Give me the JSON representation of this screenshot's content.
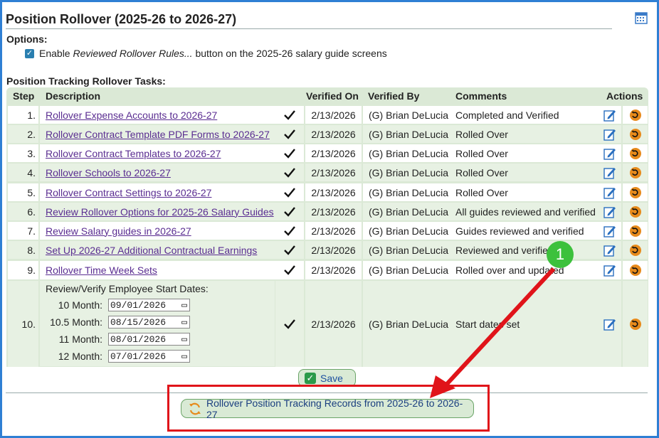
{
  "page": {
    "title": "Position Rollover (2025-26 to 2026-27)"
  },
  "options": {
    "label": "Options:",
    "enable_text_pre": "Enable ",
    "enable_text_em": "Reviewed Rollover Rules...",
    "enable_text_post": " button on the 2025-26 salary guide screens",
    "checked": true
  },
  "tasks": {
    "label": "Position Tracking Rollover Tasks:",
    "headers": {
      "step": "Step",
      "description": "Description",
      "verified_on": "Verified On",
      "verified_by": "Verified By",
      "comments": "Comments",
      "actions": "Actions"
    },
    "rows": [
      {
        "step": "1.",
        "description": "Rollover Expense Accounts to 2026-27",
        "verified_on": "2/13/2026",
        "verified_by": "(G) Brian DeLucia",
        "comments": "Completed and Verified"
      },
      {
        "step": "2.",
        "description": "Rollover Contract Template PDF Forms to 2026-27",
        "verified_on": "2/13/2026",
        "verified_by": "(G) Brian DeLucia",
        "comments": "Rolled Over"
      },
      {
        "step": "3.",
        "description": "Rollover Contract Templates to 2026-27",
        "verified_on": "2/13/2026",
        "verified_by": "(G) Brian DeLucia",
        "comments": "Rolled Over"
      },
      {
        "step": "4.",
        "description": "Rollover Schools to 2026-27",
        "verified_on": "2/13/2026",
        "verified_by": "(G) Brian DeLucia",
        "comments": "Rolled Over"
      },
      {
        "step": "5.",
        "description": "Rollover Contract Settings to 2026-27",
        "verified_on": "2/13/2026",
        "verified_by": "(G) Brian DeLucia",
        "comments": "Rolled Over"
      },
      {
        "step": "6.",
        "description": "Review Rollover Options for 2025-26 Salary Guides",
        "verified_on": "2/13/2026",
        "verified_by": "(G) Brian DeLucia",
        "comments": "All guides reviewed and verified"
      },
      {
        "step": "7.",
        "description": "Review Salary guides in 2026-27",
        "verified_on": "2/13/2026",
        "verified_by": "(G) Brian DeLucia",
        "comments": "Guides reviewed and verified"
      },
      {
        "step": "8.",
        "description": "Set Up 2026-27 Additional Contractual Earnings",
        "verified_on": "2/13/2026",
        "verified_by": "(G) Brian DeLucia",
        "comments": "Reviewed and verified"
      },
      {
        "step": "9.",
        "description": "Rollover Time Week Sets",
        "verified_on": "2/13/2026",
        "verified_by": "(G) Brian DeLucia",
        "comments": "Rolled over and updated"
      }
    ],
    "row10": {
      "step": "10.",
      "heading": "Review/Verify Employee Start Dates:",
      "dates": [
        {
          "label": "10 Month:",
          "value": "09/01/2026"
        },
        {
          "label": "10.5 Month:",
          "value": "08/15/2026"
        },
        {
          "label": "11 Month:",
          "value": "08/01/2026"
        },
        {
          "label": "12 Month:",
          "value": "07/01/2026"
        }
      ],
      "verified_on": "2/13/2026",
      "verified_by": "(G) Brian DeLucia",
      "comments": "Start dates set"
    }
  },
  "buttons": {
    "save": "Save",
    "rollover": "Rollover Position Tracking Records from 2025-26 to 2026-27"
  },
  "annotation": {
    "badge": "1"
  },
  "icons": {
    "check": "checkmark-icon",
    "edit": "edit-icon",
    "undo": "undo-icon",
    "calendar": "calendar-icon",
    "refresh": "refresh-icon"
  },
  "colors": {
    "frame": "#2f7fd4",
    "table_header": "#dbe9d6",
    "row_alt": "#e7f1e3",
    "link": "#5a2d91",
    "undo": "#e78a1b",
    "annotation_red": "#e0141a",
    "annotation_badge": "#3cc13c"
  }
}
